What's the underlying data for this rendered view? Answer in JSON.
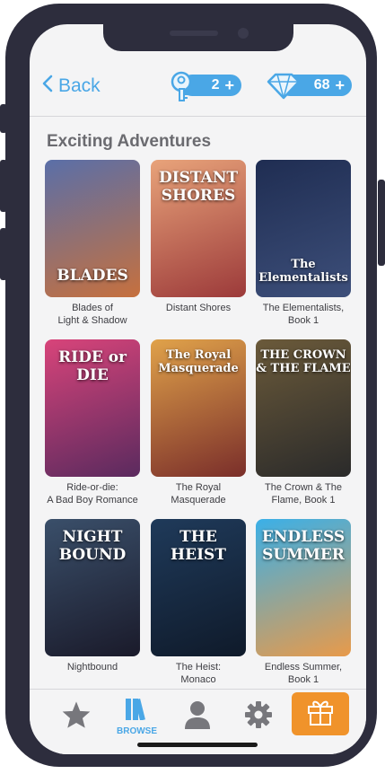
{
  "header": {
    "back_label": "Back",
    "keys_count": "2",
    "gems_count": "68",
    "plus": "+"
  },
  "section": {
    "title": "Exciting Adventures"
  },
  "books": [
    {
      "label1": "Blades of",
      "label2": "Light & Shadow",
      "cover_title": "BLADES",
      "colors": [
        "#5a6fa8",
        "#c6703e"
      ]
    },
    {
      "label1": "Distant Shores",
      "label2": "",
      "cover_title": "DISTANT SHORES",
      "colors": [
        "#e8a37a",
        "#9c3a3a"
      ]
    },
    {
      "label1": "The Elementalists,",
      "label2": "Book 1",
      "cover_title": "The Elementalists",
      "colors": [
        "#1f2d52",
        "#3d4f7a"
      ]
    },
    {
      "label1": "Ride-or-die:",
      "label2": "A Bad Boy Romance",
      "cover_title": "RIDE or DIE",
      "colors": [
        "#d8447a",
        "#5a2a5e"
      ]
    },
    {
      "label1": "The Royal",
      "label2": "Masquerade",
      "cover_title": "The Royal Masquerade",
      "colors": [
        "#e0a24a",
        "#7a2e2a"
      ]
    },
    {
      "label1": "The Crown & The",
      "label2": "Flame, Book 1",
      "cover_title": "THE CROWN & THE FLAME",
      "colors": [
        "#6b5a3a",
        "#2a2a2a"
      ]
    },
    {
      "label1": "Nightbound",
      "label2": "",
      "cover_title": "NIGHT BOUND",
      "colors": [
        "#3a4f6a",
        "#1a1a2a"
      ]
    },
    {
      "label1": "The Heist:",
      "label2": "Monaco",
      "cover_title": "THE HEIST",
      "colors": [
        "#1f3a5a",
        "#0f1a2a"
      ]
    },
    {
      "label1": "Endless Summer,",
      "label2": "Book 1",
      "cover_title": "ENDLESS SUMMER",
      "colors": [
        "#3ab0e8",
        "#e89a4a"
      ]
    }
  ],
  "tabs": {
    "browse_label": "BROWSE"
  },
  "colors": {
    "accent": "#4aa7e6",
    "gift": "#f0932b",
    "inactive": "#77777c"
  }
}
